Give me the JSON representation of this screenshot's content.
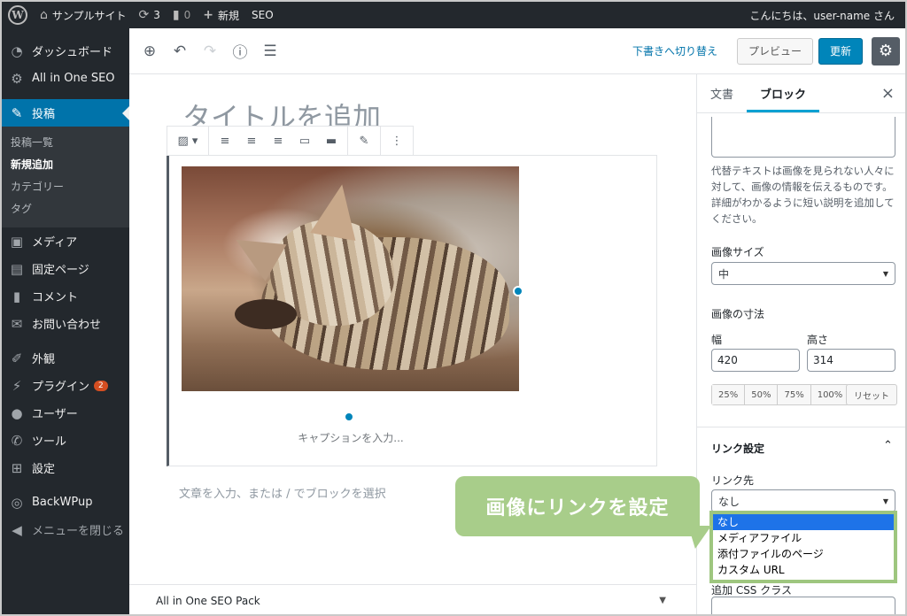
{
  "adminbar": {
    "site_name": "サンプルサイト",
    "updates_count": "3",
    "comments_count": "0",
    "new_label": "新規",
    "seo_label": "SEO",
    "greeting": "こんにちは、user-name さん"
  },
  "sidebar": {
    "dashboard": "ダッシュボード",
    "aioseo": "All in One SEO",
    "posts": "投稿",
    "posts_sub": [
      "投稿一覧",
      "新規追加",
      "カテゴリー",
      "タグ"
    ],
    "media": "メディア",
    "pages": "固定ページ",
    "comments": "コメント",
    "contact": "お問い合わせ",
    "appearance": "外観",
    "plugins": "プラグイン",
    "plugins_badge": "2",
    "users": "ユーザー",
    "tools": "ツール",
    "settings": "設定",
    "backwpup": "BackWPup",
    "collapse": "メニューを閉じる"
  },
  "toolbar": {
    "switch_draft": "下書きへ切り替え",
    "preview": "プレビュー",
    "update": "更新"
  },
  "editor": {
    "title_placeholder": "タイトルを追加",
    "caption_placeholder": "キャプションを入力...",
    "appender_placeholder": "文章を入力、または / でブロックを選択",
    "seo_pack": "All in One SEO Pack"
  },
  "panel": {
    "tab_document": "文書",
    "tab_block": "ブロック",
    "alt_help": "代替テキストは画像を見られない人々に対して、画像の情報を伝えるものです。詳細がわかるように短い説明を追加してください。",
    "image_size_label": "画像サイズ",
    "image_size_value": "中",
    "dimensions_label": "画像の寸法",
    "width_label": "幅",
    "height_label": "高さ",
    "width_value": "420",
    "height_value": "314",
    "percent_buttons": [
      "25%",
      "50%",
      "75%",
      "100%"
    ],
    "reset": "リセット",
    "link_settings": "リンク設定",
    "link_to_label": "リンク先",
    "link_to_value": "なし",
    "extra_css_label": "追加 CSS クラス"
  },
  "dropdown": {
    "options": [
      "なし",
      "メディアファイル",
      "添付ファイルのページ",
      "カスタム URL"
    ],
    "selected_index": 0
  },
  "callout": {
    "text": "画像にリンクを設定"
  },
  "colors": {
    "admin_dark": "#23282d",
    "accent_blue": "#0073aa",
    "callout_green": "#a8cd8a"
  }
}
